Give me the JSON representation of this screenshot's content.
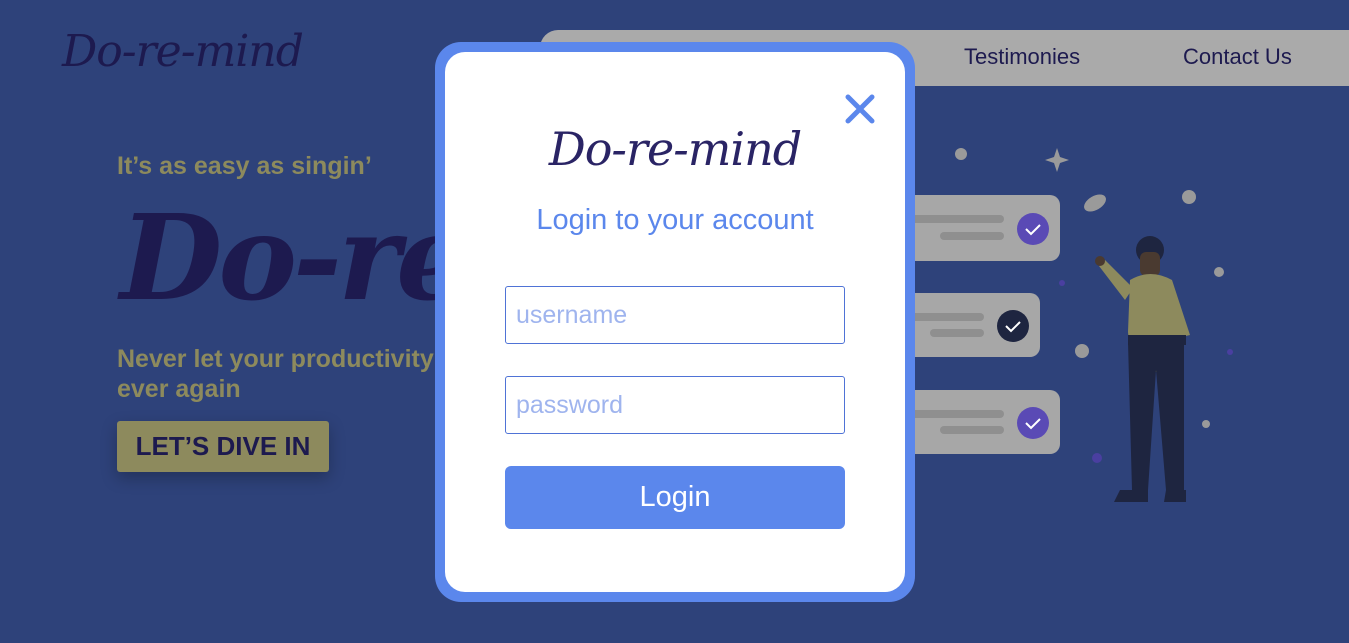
{
  "header": {
    "logo": "Do-re-mind",
    "nav": [
      "Testimonies",
      "Contact Us"
    ]
  },
  "hero": {
    "tagline": "It’s as easy as singin’",
    "title": "Do-re-mind",
    "subtitle": "Never let your productivity ever again",
    "cta_label": "LET’S DIVE IN"
  },
  "modal": {
    "logo": "Do-re-mind",
    "heading": "Login to your account",
    "username": {
      "placeholder": "username",
      "value": ""
    },
    "password": {
      "placeholder": "password",
      "value": ""
    },
    "login_label": "Login",
    "close_icon": "close-icon"
  },
  "colors": {
    "background": "#2e427a",
    "accent": "#5b87ec",
    "brand_dark": "#1d1a4f",
    "olive": "#8d8a5d"
  }
}
